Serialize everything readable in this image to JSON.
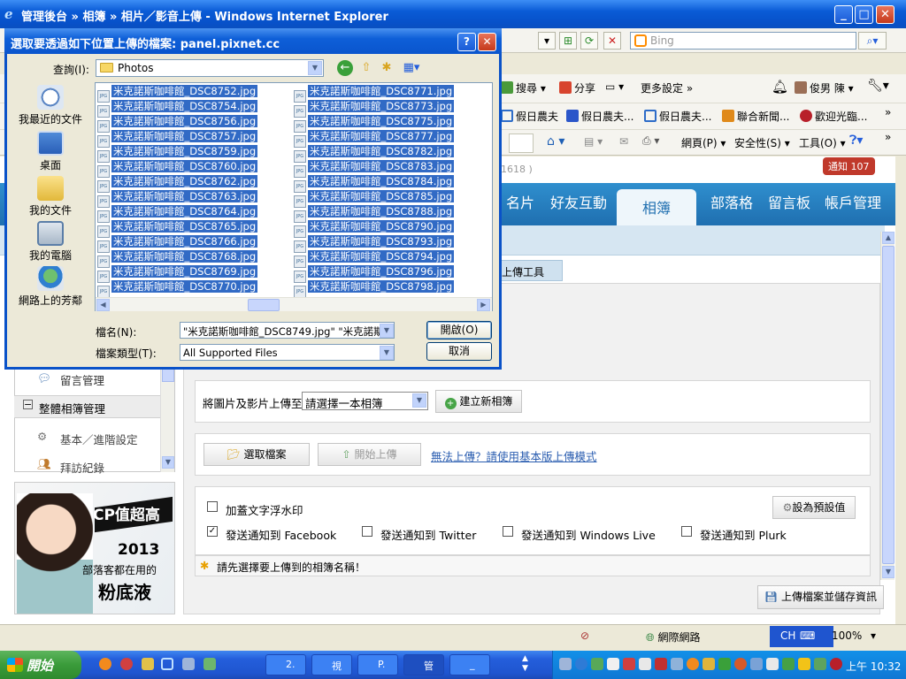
{
  "window": {
    "title": "管理後台 » 相簿 » 相片／影音上傳 - Windows Internet Explorer",
    "search_placeholder": "Bing"
  },
  "toolbar": {
    "search_label": "搜尋",
    "share_label": "分享",
    "more_settings": "更多設定",
    "user_name": "俊男 陳",
    "favorites": [
      "假日農夫",
      "假日農夫...",
      "假日農夫...",
      "聯合新聞...",
      "歡迎光臨..."
    ],
    "page_menu": "網頁(P)",
    "safety_menu": "安全性(S)",
    "tools_menu": "工具(O)"
  },
  "page": {
    "id_fragment": "1618 )",
    "notice_badge": "通知 107",
    "nav_tabs": [
      "名片",
      "好友互動",
      "相簿",
      "部落格",
      "留言板",
      "帳戶管理"
    ],
    "active_tab": "相簿",
    "upload_tool_tab": "上傳工具",
    "sidebar_items": [
      {
        "label": "留言管理",
        "icon": "comment-icon"
      },
      {
        "label": "整體相簿管理",
        "icon": "collapse-icon"
      },
      {
        "label": "基本／進階設定",
        "icon": "gear-icon"
      },
      {
        "label": "拜訪紀錄",
        "icon": "users-icon"
      }
    ],
    "ad": {
      "line1": "CP值超高",
      "line2": "2013",
      "line3": "部落客都在用的",
      "line4": "粉底液"
    },
    "upload": {
      "upload_to_label": "將圖片及影片上傳至",
      "album_select_value": "請選擇一本相簿",
      "create_album_button": "建立新相簿",
      "select_files_button": "選取檔案",
      "start_upload_button": "開始上傳",
      "basic_mode_link": "無法上傳？請使用基本版上傳模式",
      "watermark_label": "加蓋文字浮水印",
      "default_settings_button": "設為預設值",
      "notify_facebook": "發送通知到 Facebook",
      "notify_twitter": "發送通知到 Twitter",
      "notify_windows_live": "發送通知到 Windows Live",
      "notify_plurk": "發送通知到 Plurk",
      "facebook_checked": true,
      "warning": "請先選擇要上傳到的相簿名稱！",
      "save_button": "上傳檔案並儲存資訊"
    }
  },
  "dialog": {
    "title": "選取要透過如下位置上傳的檔案: panel.pixnet.cc",
    "look_in_label": "查詢(I):",
    "look_in_value": "Photos",
    "places": [
      "我最近的文件",
      "桌面",
      "我的文件",
      "我的電腦",
      "網路上的芳鄰"
    ],
    "files_col1": [
      "米克諾斯咖啡館_DSC8752.jpg",
      "米克諾斯咖啡館_DSC8754.jpg",
      "米克諾斯咖啡館_DSC8756.jpg",
      "米克諾斯咖啡館_DSC8757.jpg",
      "米克諾斯咖啡館_DSC8759.jpg",
      "米克諾斯咖啡館_DSC8760.jpg",
      "米克諾斯咖啡館_DSC8762.jpg",
      "米克諾斯咖啡館_DSC8763.jpg",
      "米克諾斯咖啡館_DSC8764.jpg",
      "米克諾斯咖啡館_DSC8765.jpg",
      "米克諾斯咖啡館_DSC8766.jpg",
      "米克諾斯咖啡館_DSC8768.jpg",
      "米克諾斯咖啡館_DSC8769.jpg",
      "米克諾斯咖啡館_DSC8770.jpg"
    ],
    "files_col2": [
      "米克諾斯咖啡館_DSC8771.jpg",
      "米克諾斯咖啡館_DSC8773.jpg",
      "米克諾斯咖啡館_DSC8775.jpg",
      "米克諾斯咖啡館_DSC8777.jpg",
      "米克諾斯咖啡館_DSC8782.jpg",
      "米克諾斯咖啡館_DSC8783.jpg",
      "米克諾斯咖啡館_DSC8784.jpg",
      "米克諾斯咖啡館_DSC8785.jpg",
      "米克諾斯咖啡館_DSC8788.jpg",
      "米克諾斯咖啡館_DSC8790.jpg",
      "米克諾斯咖啡館_DSC8793.jpg",
      "米克諾斯咖啡館_DSC8794.jpg",
      "米克諾斯咖啡館_DSC8796.jpg",
      "米克諾斯咖啡館_DSC8798.jpg"
    ],
    "file_name_label": "檔名(N):",
    "file_name_value": "\"米克諾斯咖啡館_DSC8749.jpg\" \"米克諾斯t",
    "file_type_label": "檔案類型(T):",
    "file_type_value": "All Supported Files",
    "open_button": "開啟(O)",
    "cancel_button": "取消"
  },
  "statusbar": {
    "zone": "網際網路",
    "zoom": "100%",
    "language": "CH"
  },
  "taskbar": {
    "start_label": "開始",
    "tasks": [
      "2.",
      "視",
      "P.",
      "管",
      "_"
    ],
    "clock": "上午 10:32"
  },
  "colors": {
    "xp_blue": "#0a55cd",
    "nav_blue": "#1f6fb0",
    "selection": "#316ac5",
    "notice_red": "#c0392b"
  }
}
